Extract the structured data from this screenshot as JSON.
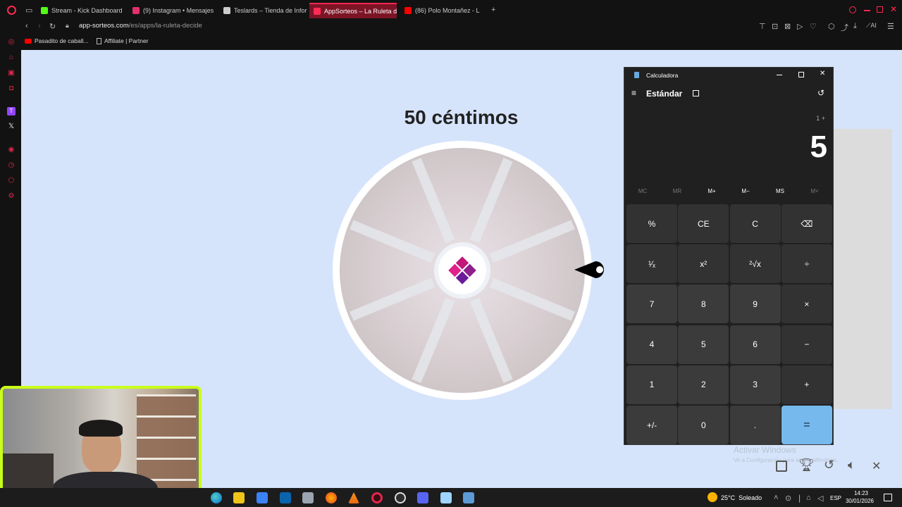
{
  "browser": {
    "tabs": [
      {
        "label": "Stream - Kick Dashboard",
        "active": false,
        "color": "#53fc18"
      },
      {
        "label": "(9) Instagram • Mensajes",
        "active": false,
        "color": "#e1306c"
      },
      {
        "label": "Teslards – Tienda de Infor",
        "active": false,
        "color": "#cccccc"
      },
      {
        "label": "AppSorteos – La Ruleta de",
        "active": true,
        "color": "#ff2d55"
      },
      {
        "label": "(86) Polo Montañez - L",
        "active": false,
        "color": "#ff0000"
      }
    ],
    "url_host": "app-sorteos.com",
    "url_path": "/es/apps/la-ruleta-decide",
    "bookmarks": [
      "Pasadito de caball...",
      "Affiliate | Partner"
    ],
    "ai_label": "AI"
  },
  "page": {
    "title": "50 céntimos"
  },
  "calculator": {
    "window_title": "Calculadora",
    "mode": "Estándar",
    "expression": "1 +",
    "display": "5",
    "memory": [
      {
        "label": "MC",
        "enabled": false
      },
      {
        "label": "MR",
        "enabled": false
      },
      {
        "label": "M+",
        "enabled": true
      },
      {
        "label": "M−",
        "enabled": true
      },
      {
        "label": "MS",
        "enabled": true
      },
      {
        "label": "M˅",
        "enabled": false
      }
    ],
    "keys": [
      [
        "%",
        "CE",
        "C",
        "⌫"
      ],
      [
        "¹⁄ₓ",
        "x²",
        "²√x",
        "÷"
      ],
      [
        "7",
        "8",
        "9",
        "×"
      ],
      [
        "4",
        "5",
        "6",
        "−"
      ],
      [
        "1",
        "2",
        "3",
        "+"
      ],
      [
        "+/-",
        "0",
        ".",
        "="
      ]
    ]
  },
  "watermark": {
    "line1": "Activar Windows",
    "line2": "Ve a Configuración para activar Windows."
  },
  "taskbar": {
    "weather": "25°C  Soleado",
    "lang": "ESP",
    "time": "14:23",
    "date": "30/01/2026"
  },
  "colors": {
    "accent": "#ff2850",
    "page_bg": "#d6e4fb",
    "equals": "#76b9ed",
    "webcam_border": "#c9ff18",
    "logo": "#c2187a"
  }
}
